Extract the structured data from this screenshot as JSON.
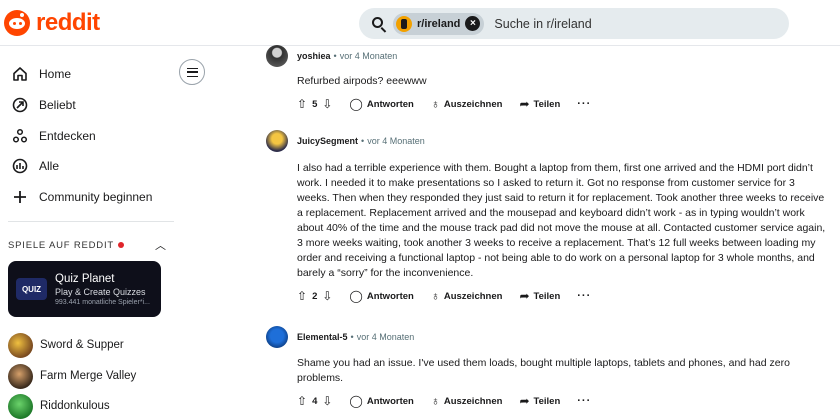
{
  "header": {
    "logo_text": "reddit",
    "brand_color": "#ff4500",
    "search": {
      "chip_label": "r/ireland",
      "placeholder": "Suche in r/ireland"
    }
  },
  "sidebar": {
    "nav": [
      {
        "label": "Home",
        "icon": "home-icon"
      },
      {
        "label": "Beliebt",
        "icon": "popular-icon"
      },
      {
        "label": "Entdecken",
        "icon": "explore-icon"
      },
      {
        "label": "Alle",
        "icon": "all-icon"
      },
      {
        "label": "Community beginnen",
        "icon": "plus-icon"
      }
    ],
    "games_section": {
      "title": "SPIELE AUF REDDIT",
      "featured": {
        "logo": "QUIZ",
        "name": "Quiz Planet",
        "subtitle": "Play & Create Quizzes",
        "meta": "993.441 monatliche Spieler*i..."
      },
      "items": [
        {
          "label": "Sword & Supper"
        },
        {
          "label": "Farm Merge Valley"
        },
        {
          "label": "Riddonkulous"
        }
      ]
    }
  },
  "comments": [
    {
      "user": "yoshiea",
      "sep": "•",
      "time": "vor 4 Monaten",
      "body": "Refurbed airpods? eeewww",
      "votes": "5",
      "reply": "Antworten",
      "award": "Auszeichnen",
      "share": "Teilen",
      "more": "···"
    },
    {
      "user": "JuicySegment",
      "sep": "•",
      "time": "vor 4 Monaten",
      "body": "I also had a terrible experience with them. Bought a laptop from them, first one arrived and the HDMI port didn’t work. I needed it to make presentations so I asked to return it. Got no response from customer service for 3 weeks. Then when they responded they just said to return it for replacement. Took another three weeks to receive a replacement. Replacement arrived and the mousepad and keyboard didn’t work - as in typing wouldn’t work about 40% of the time and the mouse track pad did not move the mouse at all. Contacted customer service again, 3 more weeks waiting, took another 3 weeks to receive a replacement. That’s 12 full weeks between loading my order and receiving a functional laptop - not being able to do work on a personal laptop for 3 whole months, and barely a “sorry” for the inconvenience.",
      "votes": "2",
      "reply": "Antworten",
      "award": "Auszeichnen",
      "share": "Teilen",
      "more": "···"
    },
    {
      "user": "Elemental-5",
      "sep": "•",
      "time": "vor 4 Monaten",
      "body": "Shame you had an issue. I've used them loads, bought multiple laptops, tablets and phones, and had zero problems.",
      "votes": "4",
      "reply": "Antworten",
      "award": "Auszeichnen",
      "share": "Teilen",
      "more": "···"
    }
  ]
}
